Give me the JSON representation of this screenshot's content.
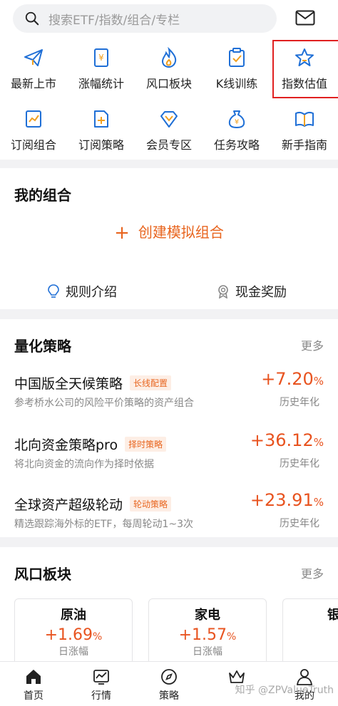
{
  "search": {
    "placeholder": "搜索ETF/指数/组合/专栏"
  },
  "header": {
    "mail_icon": "mail-icon"
  },
  "quick_grid": [
    {
      "label": "最新上市",
      "icon": "paper-plane-icon"
    },
    {
      "label": "涨幅统计",
      "icon": "yen-document-icon"
    },
    {
      "label": "风口板块",
      "icon": "flame-icon"
    },
    {
      "label": "K线训练",
      "icon": "check-document-icon"
    },
    {
      "label": "指数估值",
      "icon": "star-icon",
      "highlighted": true
    },
    {
      "label": "订阅组合",
      "icon": "chart-document-icon"
    },
    {
      "label": "订阅策略",
      "icon": "add-document-icon"
    },
    {
      "label": "会员专区",
      "icon": "diamond-icon"
    },
    {
      "label": "任务攻略",
      "icon": "money-bag-icon"
    },
    {
      "label": "新手指南",
      "icon": "open-book-icon"
    }
  ],
  "portfolio": {
    "title": "我的组合",
    "create_label": "创建模拟组合",
    "rules_label": "规则介绍",
    "reward_label": "现金奖励"
  },
  "quant": {
    "title": "量化策略",
    "more_label": "更多",
    "items": [
      {
        "name": "中国版全天候策略",
        "tag": "长线配置",
        "desc": "参考桥水公司的风险平价策略的资产组合",
        "value": "+7.20",
        "unit": "%",
        "value_label": "历史年化"
      },
      {
        "name": "北向资金策略pro",
        "tag": "择时策略",
        "desc": "将北向资金的流向作为择时依据",
        "value": "+36.12",
        "unit": "%",
        "value_label": "历史年化"
      },
      {
        "name": "全球资产超级轮动",
        "tag": "轮动策略",
        "desc": "精选跟踪海外标的ETF，每周轮动1~3次",
        "value": "+23.91",
        "unit": "%",
        "value_label": "历史年化"
      }
    ]
  },
  "sectors": {
    "title": "风口板块",
    "more_label": "更多",
    "items": [
      {
        "name": "原油",
        "value": "+1.69",
        "unit": "%",
        "label": "日涨幅"
      },
      {
        "name": "家电",
        "value": "+1.57",
        "unit": "%",
        "label": "日涨幅"
      },
      {
        "name": "银",
        "value": "",
        "unit": "",
        "label": ""
      }
    ]
  },
  "bottom_nav": [
    {
      "label": "首页",
      "icon": "home-icon"
    },
    {
      "label": "行情",
      "icon": "market-chart-icon"
    },
    {
      "label": "策略",
      "icon": "compass-icon"
    },
    {
      "label": "",
      "icon": "crown-icon"
    },
    {
      "label": "我的",
      "icon": "user-icon"
    }
  ],
  "watermark": "知乎 @ZPValueTruth",
  "colors": {
    "accent": "#e8651f",
    "positive": "#e8531f",
    "highlight_box": "#e02020",
    "icon_blue": "#1f6fd6"
  }
}
